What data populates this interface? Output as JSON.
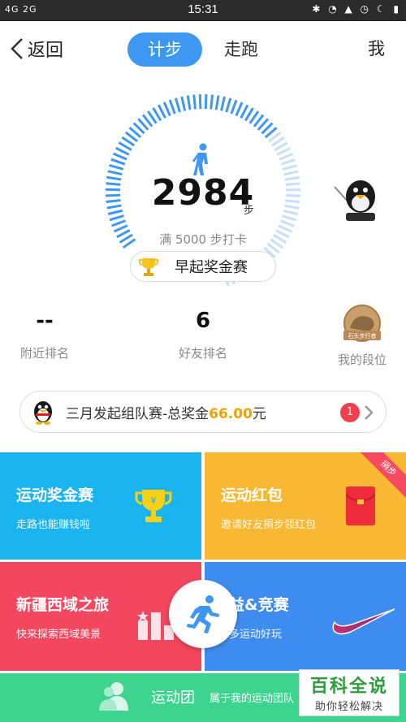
{
  "status_bar": {
    "network": "4G 2G",
    "time": "15:31",
    "icons": "bluetooth alarm silent moon battery"
  },
  "header": {
    "back_label": "返回",
    "tabs": [
      "计步",
      "走跑"
    ],
    "active_tab": "计步",
    "me_label": "我"
  },
  "dial": {
    "steps": "2984",
    "unit": "步",
    "goal_text": "满 5000 步打卡",
    "progress_fraction": 0.6,
    "morning_button": "早起奖金赛"
  },
  "ranks": [
    {
      "value": "--",
      "label": "附近排名"
    },
    {
      "value": "6",
      "label": "好友排名"
    },
    {
      "value": "",
      "label": "我的段位",
      "badge_text": "石头步行者"
    }
  ],
  "banner": {
    "text_prefix": "三月发起组队赛-总奖金",
    "amount": "66.00",
    "text_suffix": "元",
    "badge_count": "1"
  },
  "tiles": [
    {
      "title": "运动奖金赛",
      "subtitle": "走路也能赚钱啦",
      "icon": "trophy-icon"
    },
    {
      "title": "运动红包",
      "subtitle": "邀请好友捐步领红包",
      "icon": "red-envelope-icon",
      "ribbon": "捐步"
    },
    {
      "title": "新疆西域之旅",
      "subtitle": "快来探索西域美景",
      "icon": "podium-icon"
    },
    {
      "title": "益&竞赛",
      "subtitle": "多运动好玩",
      "icon": "swoosh-icon"
    }
  ],
  "team_bar": {
    "title": "运动团",
    "subtitle": "属于我的运动团队"
  },
  "watermark": {
    "line1": "百科全说",
    "line2": "助你轻松解决"
  },
  "colors": {
    "accent": "#3e97f0",
    "tile_blue": "#1ab4f0",
    "tile_yellow": "#f8b833",
    "tile_red": "#f2475f",
    "tile_blue2": "#3f8cf0",
    "team_green": "#3dd48f"
  }
}
